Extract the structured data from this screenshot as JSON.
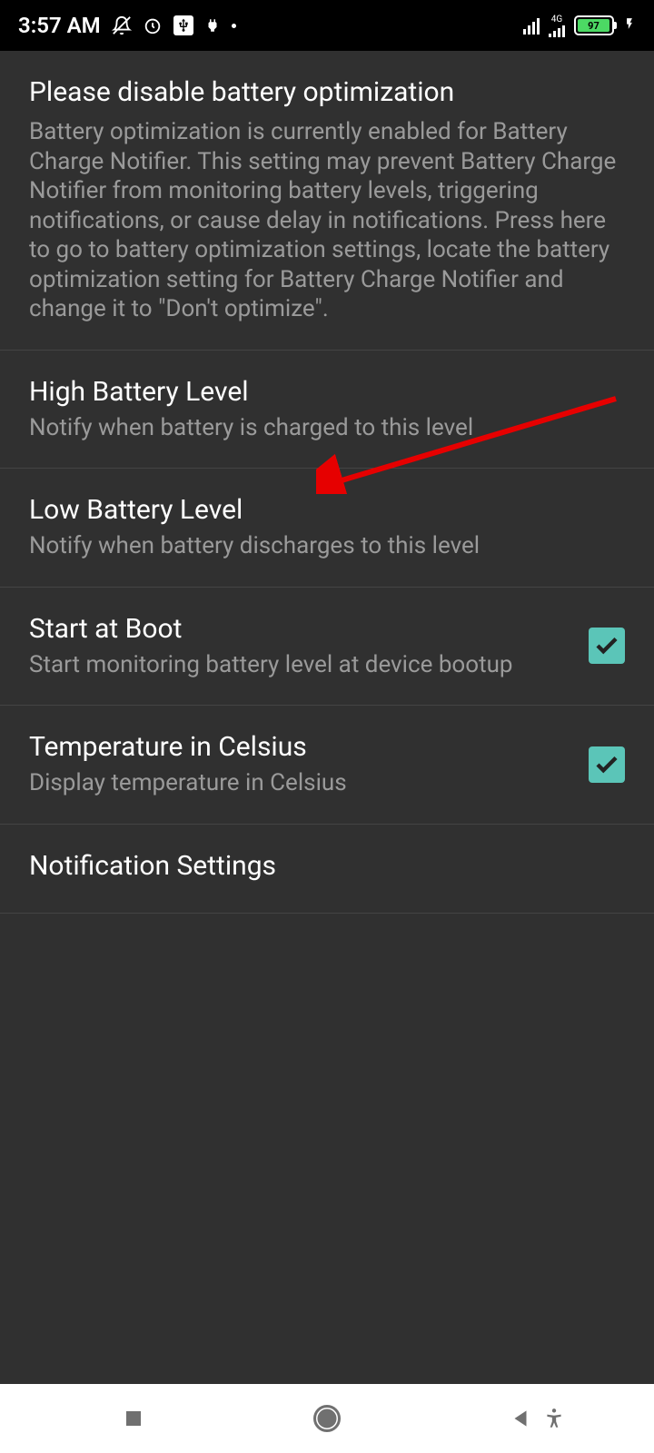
{
  "statusBar": {
    "time": "3:57 AM",
    "networkType": "4G",
    "batteryPercent": "97"
  },
  "settings": {
    "warning": {
      "title": "Please disable battery optimization",
      "description": "Battery optimization is currently enabled for Battery Charge Notifier. This setting may prevent Battery Charge Notifier from monitoring battery levels, triggering notifications, or cause delay in notifications. Press here to go to battery optimization settings, locate the battery optimization setting for Battery Charge Notifier and change it to \"Don't optimize\"."
    },
    "highBattery": {
      "title": "High Battery Level",
      "description": "Notify when battery is charged to this level"
    },
    "lowBattery": {
      "title": "Low Battery Level",
      "description": "Notify when battery discharges to this level"
    },
    "startAtBoot": {
      "title": "Start at Boot",
      "description": "Start monitoring battery level at device bootup",
      "checked": true
    },
    "temperature": {
      "title": "Temperature in Celsius",
      "description": "Display temperature in Celsius",
      "checked": true
    },
    "notificationSettings": {
      "title": "Notification Settings"
    }
  }
}
